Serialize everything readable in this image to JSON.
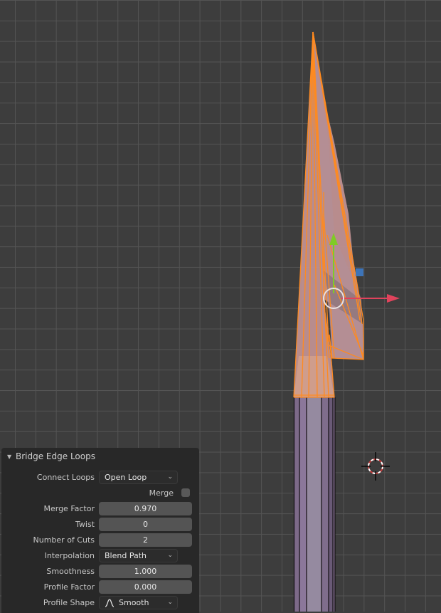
{
  "viewport": {
    "gizmo": {
      "x_axis_color": "#e0435c",
      "y_axis_color": "#7fcc24",
      "z_handle_color": "#3d74b8"
    },
    "selection_color": "#ff8a1f",
    "mesh_selected_fill": "#c08f8f",
    "mesh_unselected_fill": "#7d6a89",
    "icons": [
      "transform-gizmo",
      "3d-cursor-icon"
    ]
  },
  "operator_panel": {
    "title": "Bridge Edge Loops",
    "collapse_icon": "triangle-down-icon",
    "fields": {
      "connect_loops": {
        "label": "Connect Loops",
        "value": "Open Loop"
      },
      "merge": {
        "label": "Merge",
        "checked": false
      },
      "merge_factor": {
        "label": "Merge Factor",
        "value": "0.970"
      },
      "twist": {
        "label": "Twist",
        "value": "0"
      },
      "number_of_cuts": {
        "label": "Number of Cuts",
        "value": "2"
      },
      "interpolation": {
        "label": "Interpolation",
        "value": "Blend Path"
      },
      "smoothness": {
        "label": "Smoothness",
        "value": "1.000"
      },
      "profile_factor": {
        "label": "Profile Factor",
        "value": "0.000"
      },
      "profile_shape": {
        "label": "Profile Shape",
        "value": "Smooth",
        "icon": "smooth-falloff-icon"
      }
    }
  }
}
